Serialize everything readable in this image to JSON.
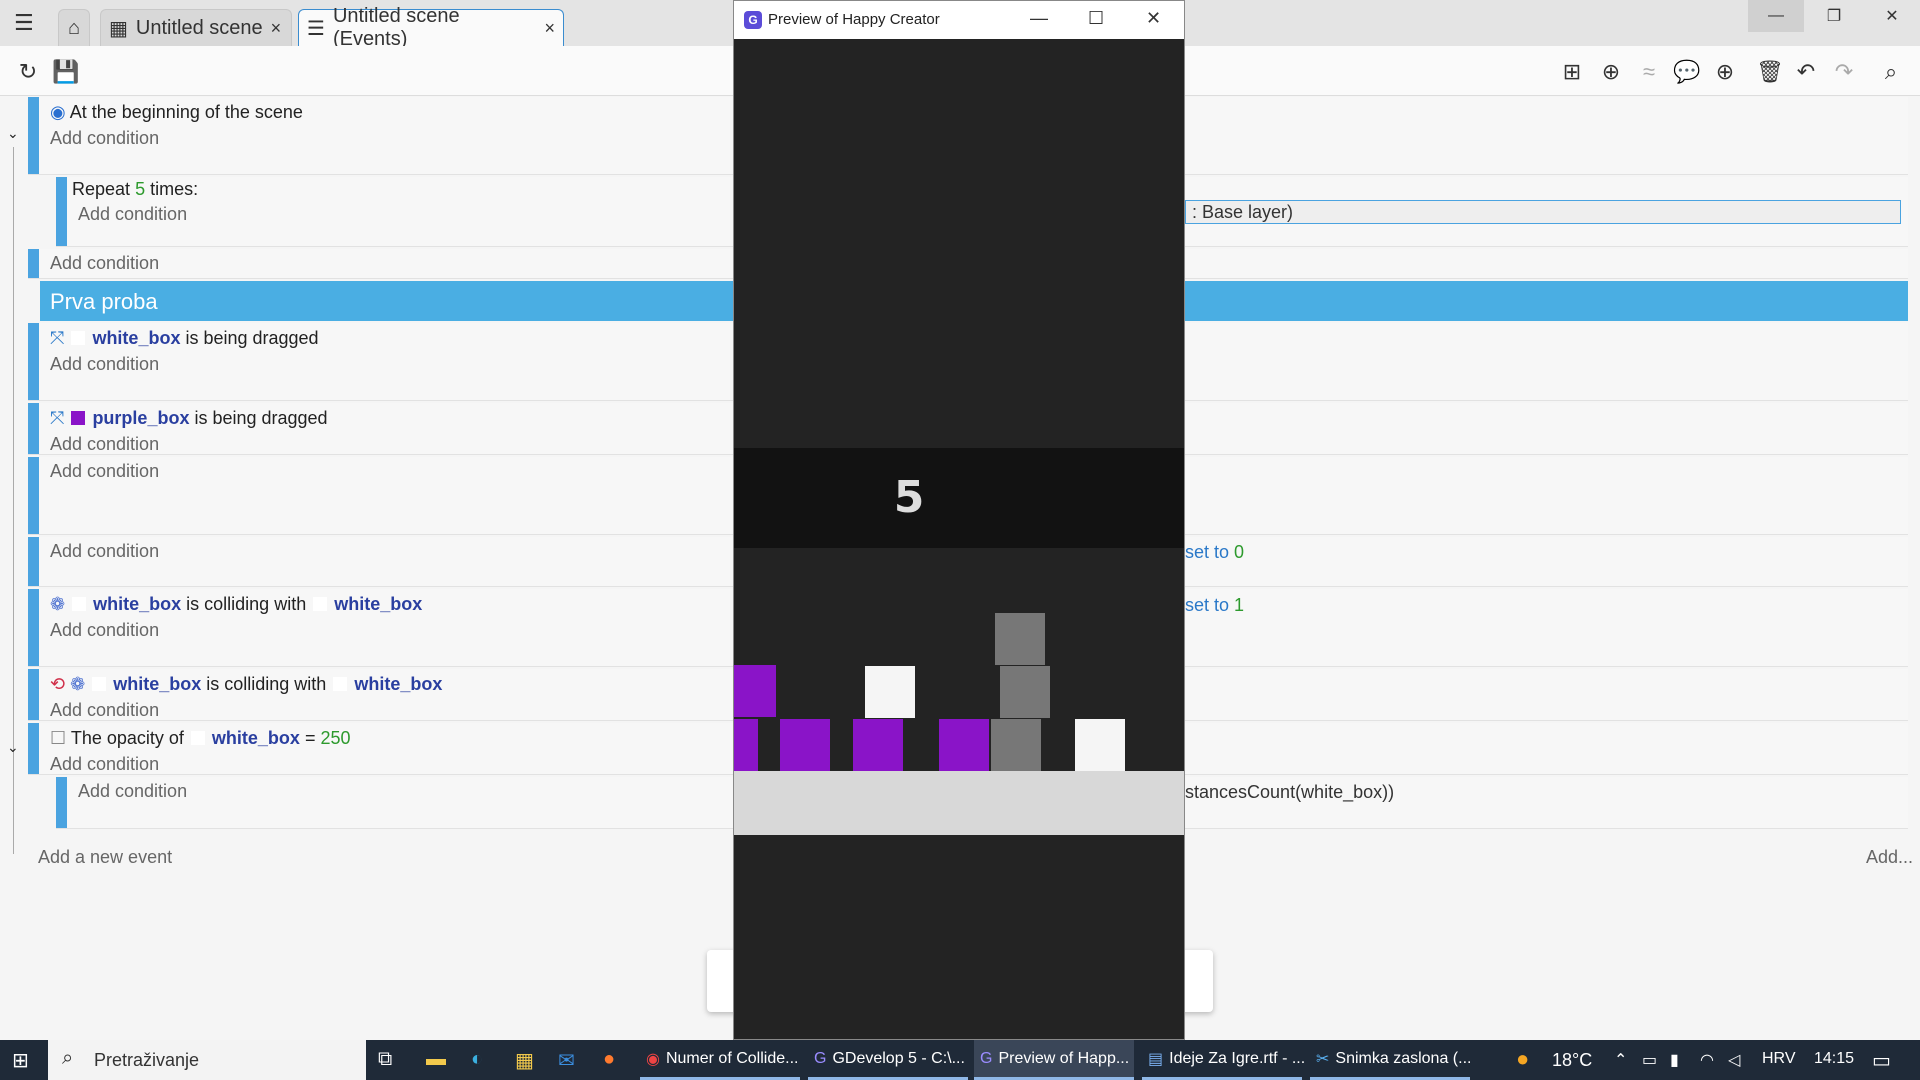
{
  "tabs": {
    "scene_tab": "Untitled scene",
    "events_tab": "Untitled scene (Events)",
    "close_glyph": "×"
  },
  "window_controls": {
    "minimize": "—",
    "restore": "❐",
    "close": "✕"
  },
  "events": {
    "e1_condition": "At the beginning of the scene",
    "add_condition": "Add condition",
    "repeat_prefix": "Repeat",
    "repeat_count": "5",
    "repeat_suffix": "times:",
    "group_name": "Prva proba",
    "white_box": "white_box",
    "purple_box": "purple_box",
    "being_dragged": "is being dragged",
    "colliding_with": "is colliding with",
    "opacity_prefix": "The opacity of",
    "opacity_op": "=",
    "opacity_value": "250",
    "add_new_event": "Add a new event",
    "add_more": "Add..."
  },
  "right_actions": {
    "base_layer": ": Base layer)",
    "set_to": "set to",
    "val0": "0",
    "val1": "1",
    "instances": "stancesCount(white_box))"
  },
  "preview": {
    "title": "Preview of Happy Creator",
    "score": "5",
    "colors": {
      "purple": "#8a14c8",
      "white": "#f5f5f5",
      "gray": "#777777",
      "bg": "#232323"
    }
  },
  "taskbar": {
    "search_placeholder": "Pretraživanje",
    "apps": [
      "Numer of Collide...",
      "GDevelop 5 - C:\\...",
      "Preview of Happ...",
      "Ideje Za Igre.rtf - ...",
      "Snimka zaslona (..."
    ],
    "temperature": "18°C",
    "language": "HRV",
    "time": "14:15"
  }
}
